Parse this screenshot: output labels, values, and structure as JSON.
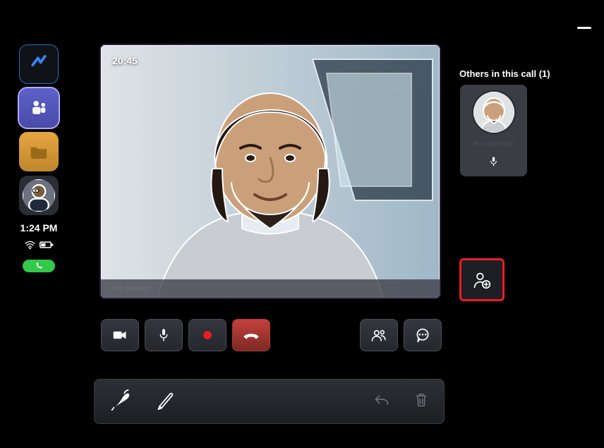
{
  "call": {
    "duration": "20:45",
    "speaker_name": "Rex Bernard",
    "participants_header": "Others in this call (1)",
    "participants": [
      {
        "name": "Rex Bernard",
        "muted": false
      }
    ]
  },
  "dock": {
    "time": "1:24 PM"
  },
  "controls": {
    "camera": "Camera",
    "mic": "Microphone",
    "record": "Record",
    "hangup": "Hang up",
    "people": "Participants",
    "chat": "Chat",
    "add_person": "Add participant"
  },
  "penbar": {
    "pen": "Pen",
    "pencil": "Pencil",
    "undo": "Undo",
    "delete": "Delete"
  }
}
